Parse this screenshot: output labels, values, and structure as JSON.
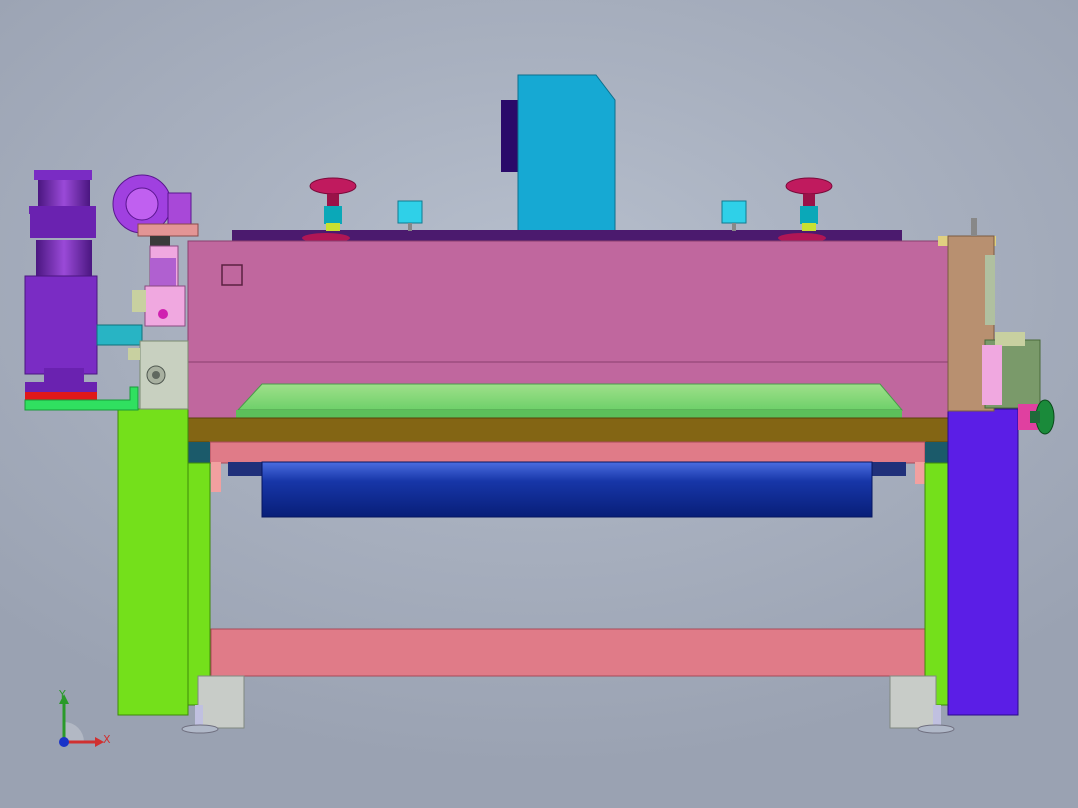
{
  "scene": {
    "background_top": "#b7bfcd",
    "background_bottom": "#9aa2b2"
  },
  "triad": {
    "x_label": "X",
    "y_label": "Y",
    "x_color": "#d03030",
    "y_color": "#2a9a2a",
    "z_color": "#1a33c8"
  },
  "colors": {
    "main_housing": "#c0679e",
    "motor_block": "#16a9d3",
    "left_leg": "#74e01b",
    "right_frame": "#5b1ee6",
    "brown_beam": "#836514",
    "pink_beam": "#e07b88",
    "roller": "#0a2a92",
    "gear_motor": "#7a2cc4",
    "handwheel": "#b8185a"
  }
}
